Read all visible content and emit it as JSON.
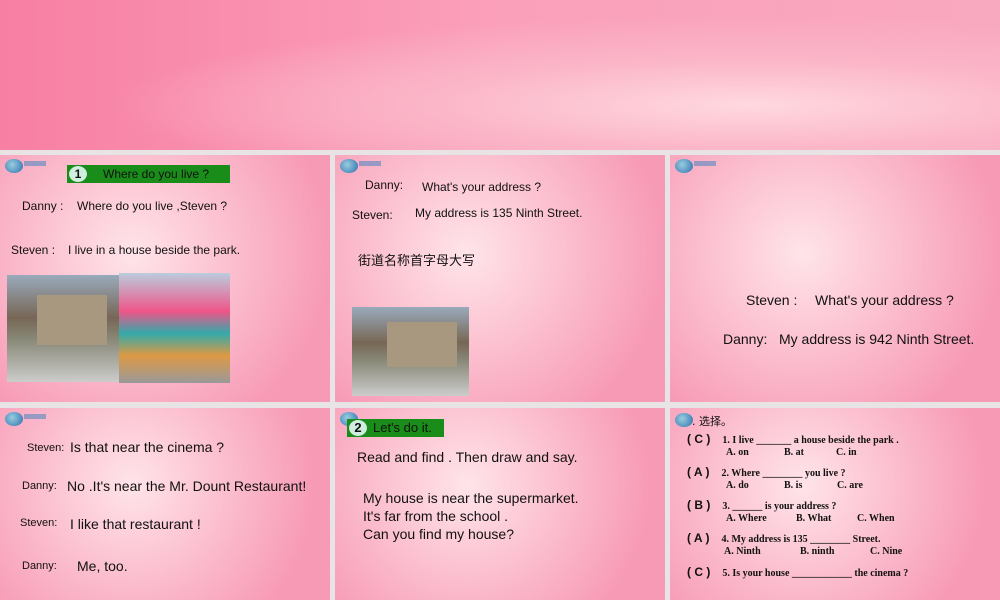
{
  "slide1": {
    "badge": "1",
    "title": "Where  do you live ?",
    "line1_speaker": "Danny :",
    "line1_text": "Where  do you live ,Steven ?",
    "line2_speaker": "Steven :",
    "line2_text": "I live in a house beside the park."
  },
  "slide2": {
    "line1_speaker": "Danny:",
    "line1_text": "What's your address ?",
    "line2_speaker": "Steven:",
    "line2_text": "My address is 135 Ninth Street.",
    "note": "街道名称首字母大写"
  },
  "slide3": {
    "line1_speaker": "Steven :",
    "line1_text": "What's your address ?",
    "line2_speaker": "Danny:",
    "line2_text": "My address is 942 Ninth Street."
  },
  "slide4": {
    "lines": [
      {
        "speaker": "Steven:",
        "text": "Is that near the cinema ?"
      },
      {
        "speaker": "Danny:",
        "text": "No .It's near the Mr. Dount Restaurant!"
      },
      {
        "speaker": "Steven:",
        "text": "I like that restaurant !"
      },
      {
        "speaker": "Danny:",
        "text": "Me, too."
      }
    ]
  },
  "slide5": {
    "badge": "2",
    "title": "Let's do it.",
    "instruction": "Read and find . Then draw and say.",
    "p1": "My house is near the supermarket.",
    "p2": "It's far from the school .",
    "p3": "Can you find my house?"
  },
  "slide6": {
    "heading": ". 选择。",
    "questions": [
      {
        "answer": "C",
        "q": "1. I live _______ a house beside the park .",
        "opts": [
          "A. on",
          "B. at",
          "C. in"
        ]
      },
      {
        "answer": "A",
        "q": "2. Where ________ you live ?",
        "opts": [
          "A. do",
          "B. is",
          "C. are"
        ]
      },
      {
        "answer": "B",
        "q": "3. ______ is your address ?",
        "opts": [
          "A. Where",
          "B. What",
          "C. When"
        ]
      },
      {
        "answer": "A",
        "q": "4. My address is 135 ________ Street.",
        "opts": [
          "A. Ninth",
          "B. ninth",
          "C. Nine"
        ]
      },
      {
        "answer": "C",
        "q": "5. Is your house ____________ the cinema ?"
      }
    ]
  }
}
